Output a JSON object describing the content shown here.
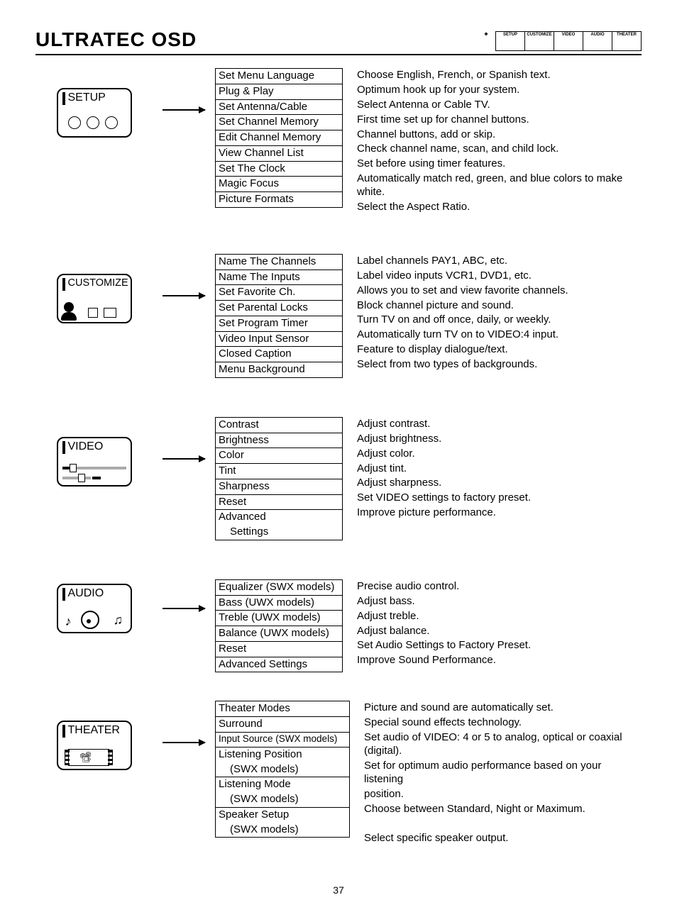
{
  "title": "ULTRATEC OSD",
  "page_number": "37",
  "header_tabs": [
    "SETUP",
    "CUSTOMIZE",
    "VIDEO",
    "AUDIO",
    "THEATER"
  ],
  "sections": {
    "setup": {
      "label": "SETUP",
      "items": [
        "Set Menu Language",
        "Plug & Play",
        "Set Antenna/Cable",
        "Set Channel Memory",
        "Edit Channel Memory",
        "View Channel List",
        "Set The Clock",
        "Magic Focus",
        "Picture Formats"
      ],
      "desc": [
        "Choose English, French, or Spanish text.",
        "Optimum hook up for your system.",
        "Select Antenna or Cable TV.",
        "First time set up for channel buttons.",
        "Channel buttons, add or skip.",
        "Check channel name, scan, and child lock.",
        "Set before using timer features.",
        "Automatically match red, green, and blue colors to make white.",
        "Select  the Aspect Ratio."
      ]
    },
    "customize": {
      "label": "CUSTOMIZE",
      "items": [
        "Name The Channels",
        "Name The Inputs",
        "Set Favorite Ch.",
        "Set Parental Locks",
        "Set Program Timer",
        "Video Input Sensor",
        "Closed Caption",
        "Menu Background"
      ],
      "desc": [
        "Label channels PAY1, ABC, etc.",
        "Label video inputs VCR1, DVD1, etc.",
        "Allows you to set and view favorite channels.",
        "Block channel picture and sound.",
        "Turn TV on and off once, daily, or weekly.",
        "Automatically turn TV on to VIDEO:4 input.",
        "Feature to display dialogue/text.",
        "Select from two types of backgrounds."
      ]
    },
    "video": {
      "label": "VIDEO",
      "items": [
        "Contrast",
        "Brightness",
        "Color",
        "Tint",
        "Sharpness",
        "Reset",
        "Advanced"
      ],
      "extra_row": "Settings",
      "desc": [
        "Adjust contrast.",
        "Adjust brightness.",
        "Adjust color.",
        "Adjust tint.",
        "Adjust sharpness.",
        "Set VIDEO settings to factory preset.",
        "Improve picture performance."
      ]
    },
    "audio": {
      "label": "AUDIO",
      "items": [
        "Equalizer (SWX models)",
        "Bass (UWX models)",
        "Treble (UWX models)",
        "Balance (UWX models)",
        "Reset",
        "Advanced Settings"
      ],
      "desc": [
        "Precise audio control.",
        "Adjust bass.",
        "Adjust treble.",
        "Adjust balance.",
        "Set Audio Settings to Factory Preset.",
        "Improve Sound Performance."
      ]
    },
    "theater": {
      "label": "THEATER",
      "items": [
        "Theater Modes",
        "Surround",
        "Input Source (SWX models)",
        "Listening Position"
      ],
      "sub1": "(SWX models)",
      "item5": "Listening Mode",
      "sub2": "(SWX models)",
      "item6": "Speaker Setup",
      "sub3": "(SWX models)",
      "desc": [
        "Picture and sound are automatically set.",
        "Special sound effects technology.",
        "Set audio of VIDEO: 4 or 5 to analog, optical or coaxial (digital).",
        "Set for optimum audio performance based on your listening",
        "position.",
        "Choose between Standard, Night or Maximum.",
        "",
        "Select specific speaker output."
      ]
    }
  }
}
